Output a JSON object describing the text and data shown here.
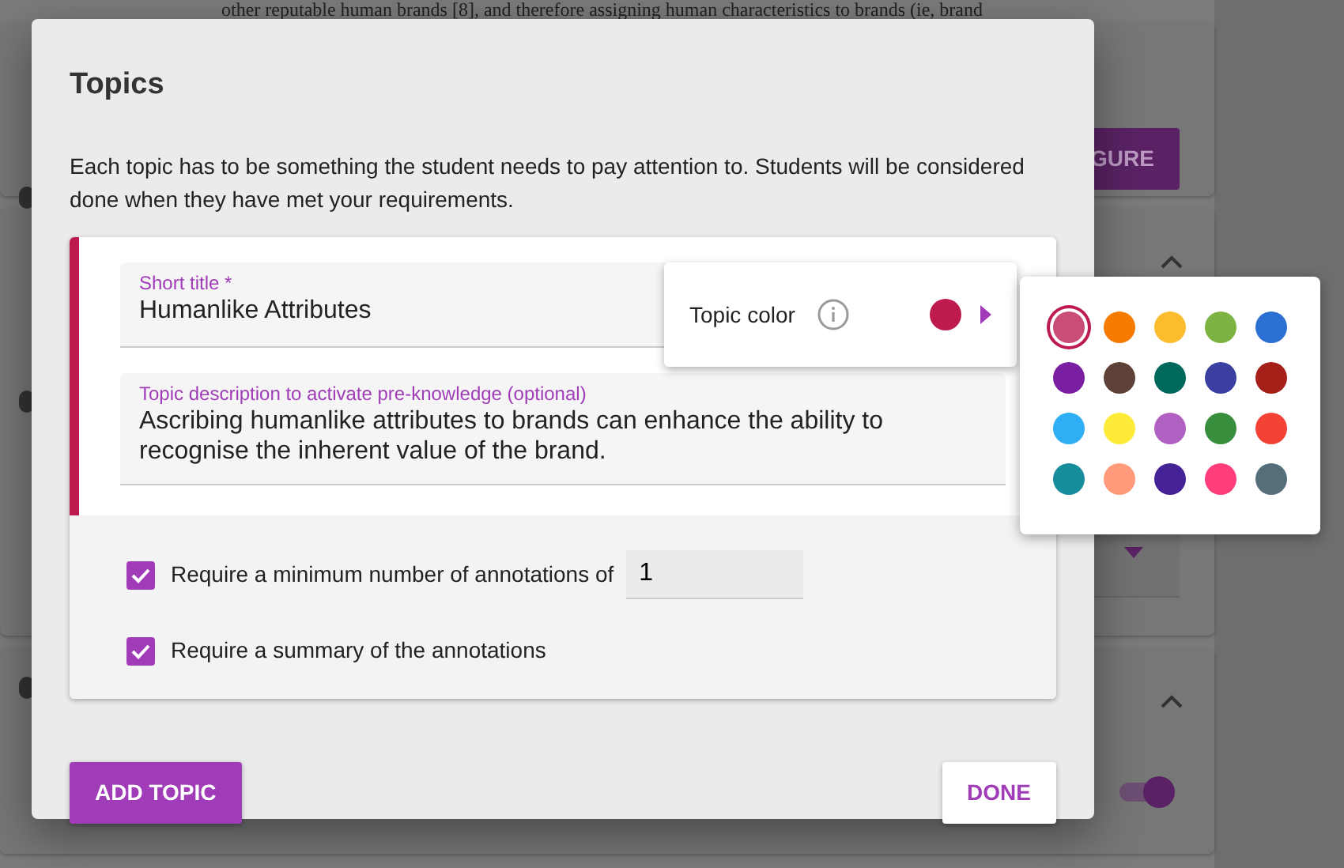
{
  "background": {
    "text": "other reputable human brands [8], and therefore assigning human characteristics to brands (ie, brand",
    "button_label": "GURE",
    "toggle_on": true
  },
  "dialog": {
    "title": "Topics",
    "description": "Each topic has to be something the student needs to pay attention to. Students will be considered done when they have met your requirements.",
    "topic": {
      "color": "#bd1a4d",
      "short_title": {
        "label": "Short title *",
        "value": "Humanlike Attributes"
      },
      "description_field": {
        "label": "Topic description to activate pre-knowledge (optional)",
        "value": "Ascribing humanlike attributes to brands can enhance the ability to recognise the inherent value of the brand."
      },
      "color_picker": {
        "label": "Topic color",
        "expanded": true
      },
      "requirements": [
        {
          "label": "Require a minimum number of annotations of",
          "checked": true,
          "value": "1"
        },
        {
          "label": "Require a summary of the annotations",
          "checked": true
        }
      ]
    },
    "buttons": [
      {
        "label": "ADD TOPIC",
        "kind": "primary"
      },
      {
        "label": "DONE",
        "kind": "plain"
      }
    ]
  },
  "palette": [
    {
      "color": "#c94d74",
      "selected": true
    },
    {
      "color": "#f57c00",
      "selected": false
    },
    {
      "color": "#fbbc2d",
      "selected": false
    },
    {
      "color": "#7cb342",
      "selected": false
    },
    {
      "color": "#2a6fd1",
      "selected": false
    },
    {
      "color": "#7b1fa2",
      "selected": false
    },
    {
      "color": "#5d4037",
      "selected": false
    },
    {
      "color": "#00695c",
      "selected": false
    },
    {
      "color": "#3a3fa0",
      "selected": false
    },
    {
      "color": "#a52019",
      "selected": false
    },
    {
      "color": "#2eaff5",
      "selected": false
    },
    {
      "color": "#fdeb37",
      "selected": false
    },
    {
      "color": "#b161c2",
      "selected": false
    },
    {
      "color": "#388e3c",
      "selected": false
    },
    {
      "color": "#f44336",
      "selected": false
    },
    {
      "color": "#168c9c",
      "selected": false
    },
    {
      "color": "#ff9a7a",
      "selected": false
    },
    {
      "color": "#452296",
      "selected": false
    },
    {
      "color": "#ff3d7a",
      "selected": false
    },
    {
      "color": "#546e7a",
      "selected": false
    }
  ]
}
